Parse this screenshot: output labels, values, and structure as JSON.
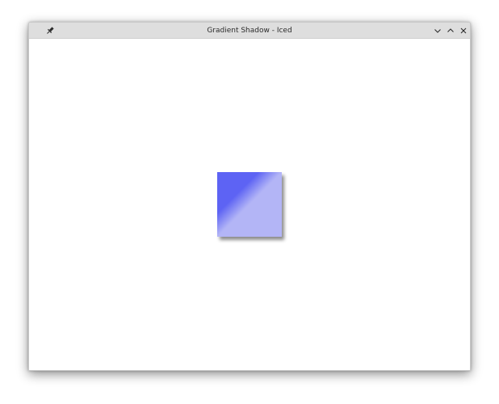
{
  "window": {
    "title": "Gradient Shadow - Iced"
  },
  "titlebar": {
    "pin_icon": "pin-icon",
    "minimize_icon": "chevron-down-icon",
    "maximize_icon": "chevron-up-icon",
    "close_icon": "close-icon"
  },
  "colors": {
    "gradient_start": "#5d63f4",
    "gradient_end": "#b3b5f6",
    "titlebar_bg": "#dedede",
    "content_bg": "#ffffff"
  }
}
